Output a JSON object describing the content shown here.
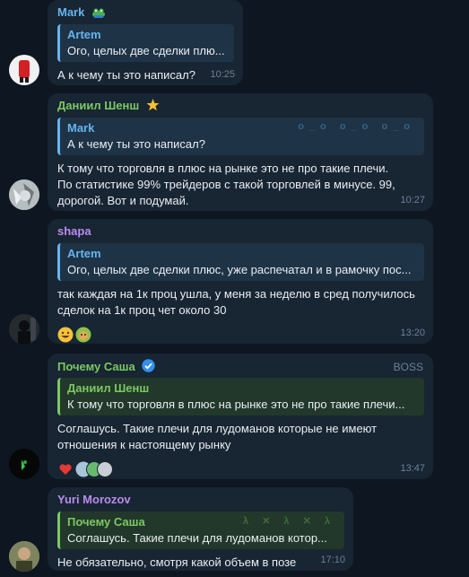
{
  "messages": [
    {
      "sender": "Mark",
      "sender_color": "#64b5ef",
      "sender_badge": "frog-emoji-icon",
      "reply": {
        "name": "Artem",
        "text": "Ого, целых две сделки плю..."
      },
      "text": "А к чему ты это написал?",
      "time": "10:25"
    },
    {
      "sender": "Даниил Шенш",
      "sender_color": "#7bc862",
      "sender_badge": "star-icon",
      "reply": {
        "name": "Mark",
        "text": "А к чему ты это написал?"
      },
      "text": "К тому что торговля в плюс на рынке это не про такие плечи. По статистике 99% трейдеров с такой торговлей в минусе. 99, дорогой. Вот и подумай.",
      "time": "10:27"
    },
    {
      "sender": "shapa",
      "sender_color": "#b98cef",
      "reply": {
        "name": "Artem",
        "text": "Ого, целых две сделки плюс, уже распечатал и в рамочку пос..."
      },
      "text": "так каждая на 1к проц ушла, у меня за неделю в сред получилось сделок на 1к проц чет около 30",
      "time": "13:20",
      "reactions": [
        "grinning-emoji-icon",
        "sticker-reaction-icon"
      ]
    },
    {
      "sender": "Почему Саша",
      "sender_color": "#7bc862",
      "sender_badge": "verified-icon",
      "role": "BOSS",
      "reply": {
        "name": "Даниил Шенш",
        "text": "К тому что торговля в плюс на рынке это не про такие плечи..."
      },
      "text": "Соглашусь. Такие плечи для лудоманов которые не имеют отношения к настоящему рынку",
      "time": "13:47",
      "reactions": [
        "heart-icon",
        "reactor-avatars-icon"
      ]
    },
    {
      "sender": "Yuri Morozov",
      "sender_color": "#b98cef",
      "reply": {
        "name": "Почему Саша",
        "text": "Соглашусь. Такие плечи для лудоманов котор..."
      },
      "text": "Не обязательно, смотря какой объем в позе",
      "time": "17:10"
    }
  ]
}
